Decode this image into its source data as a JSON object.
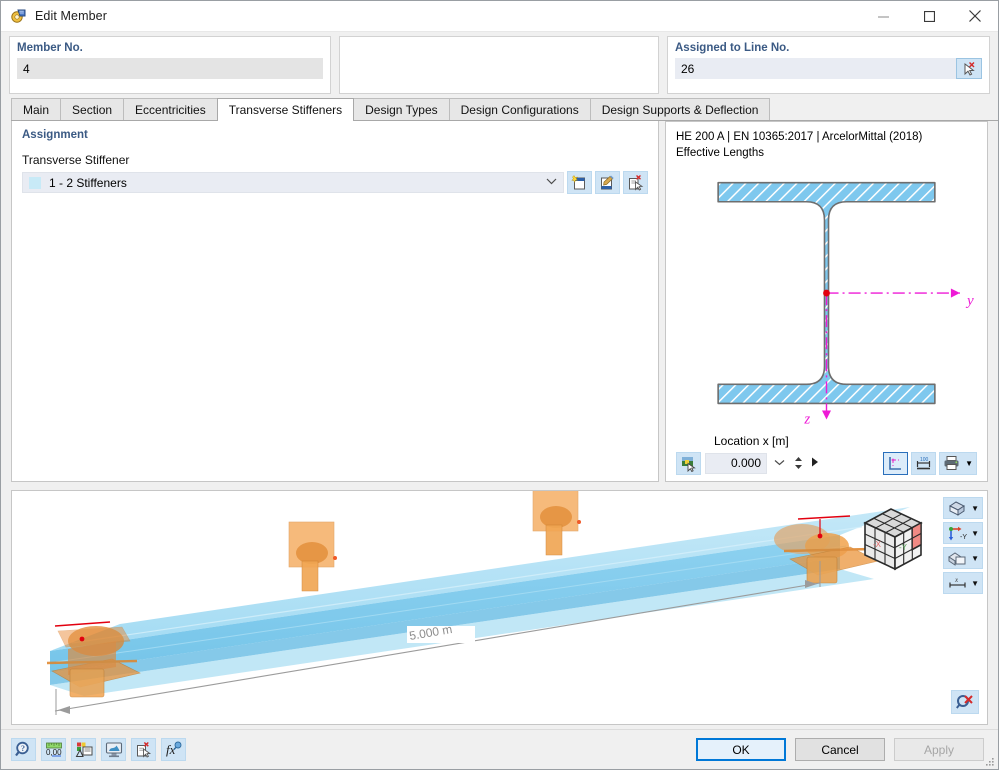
{
  "window": {
    "title": "Edit Member",
    "icon": "edit-member-icon",
    "controls": {
      "minimize": "—",
      "maximize": "□",
      "close": "✕"
    }
  },
  "header": {
    "member_no": {
      "label": "Member No.",
      "value": "4"
    },
    "assigned_line": {
      "label": "Assigned to Line No.",
      "value": "26",
      "pick_icon": "pick-line-icon"
    }
  },
  "tabs": [
    {
      "label": "Main",
      "active": false
    },
    {
      "label": "Section",
      "active": false
    },
    {
      "label": "Eccentricities",
      "active": false
    },
    {
      "label": "Transverse Stiffeners",
      "active": true
    },
    {
      "label": "Design Types",
      "active": false
    },
    {
      "label": "Design Configurations",
      "active": false
    },
    {
      "label": "Design Supports & Deflection",
      "active": false
    }
  ],
  "left_panel": {
    "section_title": "Assignment",
    "field_label": "Transverse Stiffener",
    "combo_value": "1 - 2 Stiffeners",
    "combo_swatch_color": "#c8eaf7",
    "buttons": [
      {
        "name": "new-stiffener-button",
        "icon": "new-document-icon"
      },
      {
        "name": "edit-stiffener-button",
        "icon": "edit-document-icon"
      },
      {
        "name": "delete-stiffener-button",
        "icon": "delete-document-icon"
      }
    ]
  },
  "right_panel": {
    "section_line1": "HE 200 A | EN 10365:2017 | ArcelorMittal (2018)",
    "section_line2": "Effective Lengths",
    "axis_labels": {
      "y": "y",
      "z": "z"
    },
    "location": {
      "label": "Location x [m]",
      "value": "0.000",
      "render_button_icon": "render-section-icon",
      "tool_buttons": [
        {
          "name": "show-axes-button",
          "icon": "axes-icon",
          "selected": true
        },
        {
          "name": "show-dimensions-button",
          "icon": "dimensions-icon",
          "selected": false
        },
        {
          "name": "print-button",
          "icon": "printer-icon",
          "selected": false
        }
      ]
    }
  },
  "viewport": {
    "dimension_label": "5.000 m",
    "navigation_cube": "view-cube",
    "toolbar": [
      {
        "name": "view-mode-button",
        "icon": "wireframe-cube-icon"
      },
      {
        "name": "view-direction-button",
        "icon": "axis-orientation-icon",
        "label": "-Y"
      },
      {
        "name": "render-mode-button",
        "icon": "solid-shading-icon"
      },
      {
        "name": "dimension-display-button",
        "icon": "dimension-x-icon",
        "label": "x"
      }
    ],
    "zoom_reset": {
      "name": "zoom-reset-button",
      "icon": "zoom-cancel-icon"
    }
  },
  "bottom_bar": {
    "tools": [
      {
        "name": "info-button",
        "icon": "info-magnifier-icon"
      },
      {
        "name": "units-button",
        "icon": "units-ruler-icon"
      },
      {
        "name": "display-properties-button",
        "icon": "display-properties-icon"
      },
      {
        "name": "graphic-button",
        "icon": "monitor-graphic-icon"
      },
      {
        "name": "delete-entry-button",
        "icon": "delete-entry-icon"
      },
      {
        "name": "formula-button",
        "icon": "formula-fx-icon"
      }
    ],
    "buttons": {
      "ok": "OK",
      "cancel": "Cancel",
      "apply": "Apply"
    }
  }
}
